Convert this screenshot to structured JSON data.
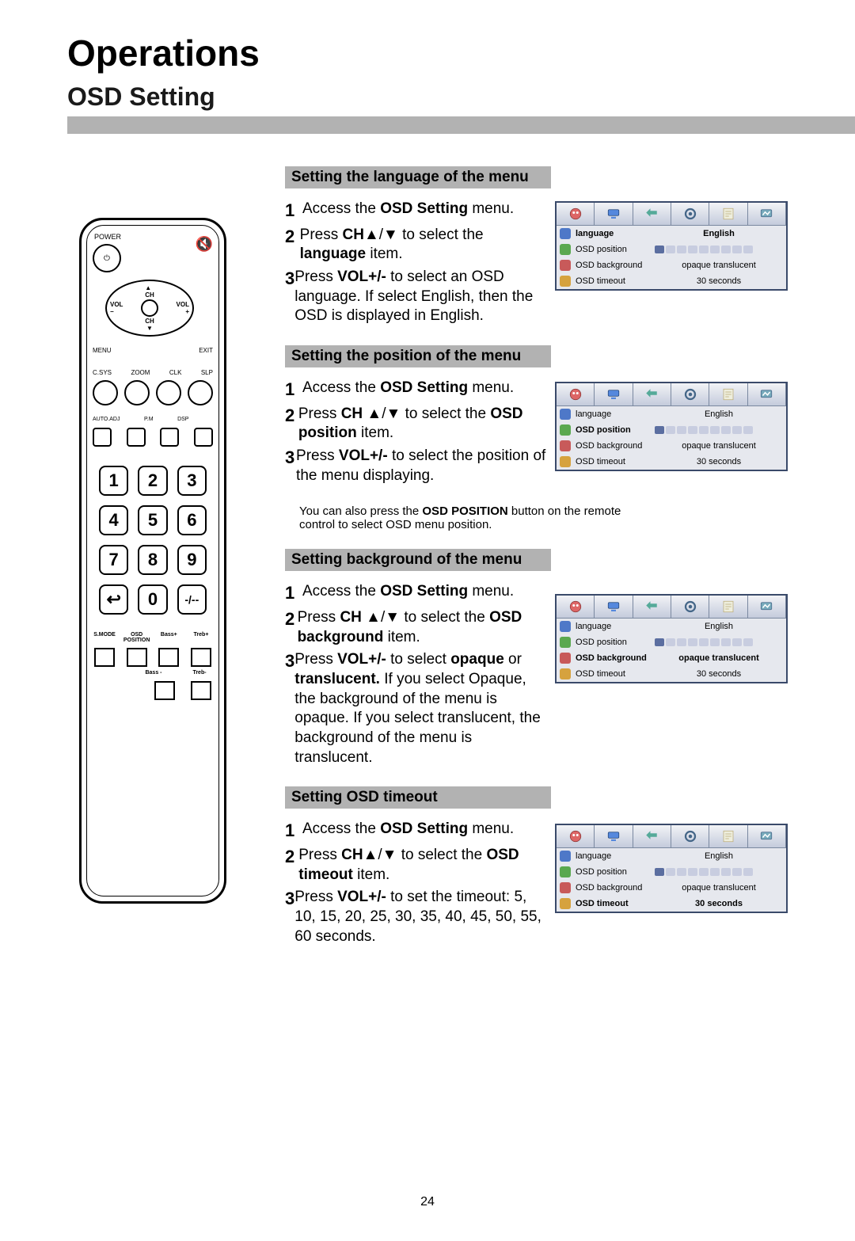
{
  "page": {
    "title": "Operations",
    "section": "OSD Setting",
    "number": "24"
  },
  "remote": {
    "power": "POWER",
    "nav": {
      "ch_up": "CH",
      "ch_dn": "CH",
      "vol_l": "VOL\n−",
      "vol_r": "VOL\n+"
    },
    "row1": {
      "menu": "MENU",
      "exit": "EXIT"
    },
    "row2": [
      "C.SYS",
      "ZOOM",
      "CLK",
      "SLP"
    ],
    "row3": [
      "AUTO.ADJ",
      "P.M",
      "DSP",
      ""
    ],
    "keys": [
      "1",
      "2",
      "3",
      "4",
      "5",
      "6",
      "7",
      "8",
      "9",
      "",
      "0",
      "-/--"
    ],
    "bottom": [
      "S.MODE",
      "OSD\nPOSITION",
      "Bass+",
      "Treb+",
      "",
      "",
      "Bass -",
      "Treb-"
    ]
  },
  "sections": [
    {
      "title": "Setting the language of the menu",
      "steps": [
        [
          "Access the ",
          "OSD Setting",
          " menu."
        ],
        [
          "Press ",
          "CH",
          "▲/▼ to select the ",
          "language",
          " item."
        ],
        [
          "Press ",
          "VOL+/-",
          " to select an OSD language. If select English, then the OSD is displayed in English."
        ]
      ],
      "menu_sel": 0
    },
    {
      "title": "Setting the position of the menu",
      "steps": [
        [
          "Access the ",
          "OSD Setting",
          " menu."
        ],
        [
          "Press ",
          "CH",
          " ▲/▼ to select the ",
          "OSD position",
          " item."
        ],
        [
          "Press ",
          "VOL+/-",
          " to select the position of the menu displaying."
        ]
      ],
      "note": [
        "You can also press the ",
        "OSD POSITION",
        " button on the remote control to select OSD menu position."
      ],
      "menu_sel": 1
    },
    {
      "title": "Setting background of the menu",
      "steps": [
        [
          "Access the ",
          "OSD Setting",
          " menu."
        ],
        [
          "Press ",
          "CH",
          " ▲/▼ to select the ",
          "OSD background",
          " item."
        ],
        [
          "Press ",
          "VOL+/-",
          " to select ",
          "opaque",
          " or ",
          "translucent.",
          " If you select Opaque, the background of the menu is opaque. If you select translucent, the background of the menu is translucent."
        ]
      ],
      "menu_sel": 2
    },
    {
      "title": "Setting OSD timeout",
      "steps": [
        [
          "Access the ",
          "OSD Setting",
          " menu."
        ],
        [
          "Press ",
          "CH",
          "▲/▼  to select the ",
          "OSD timeout",
          " item."
        ],
        [
          "Press ",
          "VOL+/-",
          " to set the timeout: 5, 10, 15, 20, 25, 30, 35, 40, 45, 50, 55, 60 seconds."
        ]
      ],
      "menu_sel": 3
    }
  ],
  "osd": {
    "rows": [
      {
        "icon": "b",
        "label": "language",
        "value": "English"
      },
      {
        "icon": "g",
        "label": "OSD position",
        "value": "pos"
      },
      {
        "icon": "r",
        "label": "OSD background",
        "value": "opaque    translucent"
      },
      {
        "icon": "y",
        "label": "OSD timeout",
        "value": "30 seconds"
      }
    ]
  }
}
